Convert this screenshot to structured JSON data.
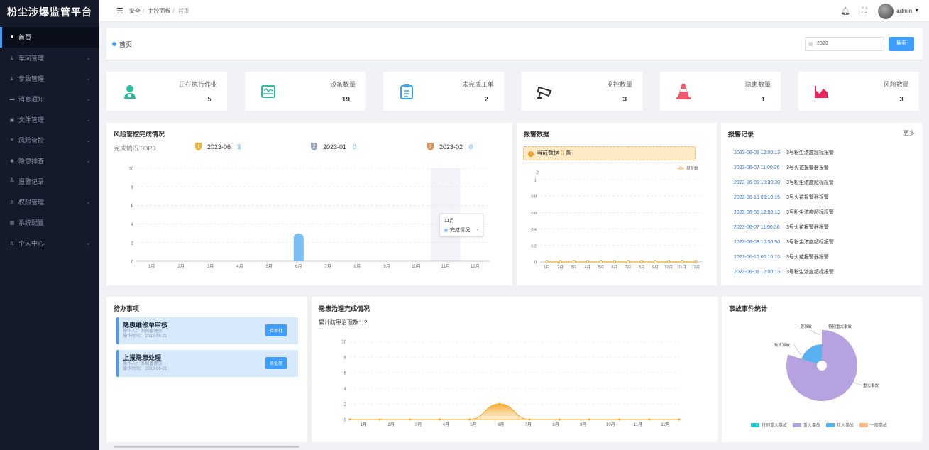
{
  "app": {
    "title": "粉尘涉爆监管平台"
  },
  "sidebar": {
    "items": [
      {
        "label": "首页",
        "icon": "home-icon",
        "glyph": "■"
      },
      {
        "label": "车间管理",
        "icon": "user-icon",
        "glyph": "ﾑ"
      },
      {
        "label": "参数管理",
        "icon": "user-icon",
        "glyph": "ﾑ"
      },
      {
        "label": "消息通知",
        "icon": "message-icon",
        "glyph": "▬"
      },
      {
        "label": "文件管理",
        "icon": "file-icon",
        "glyph": "▣"
      },
      {
        "label": "风险管控",
        "icon": "list-icon",
        "glyph": "≡"
      },
      {
        "label": "隐患排查",
        "icon": "gear-icon",
        "glyph": "✱"
      },
      {
        "label": "报警记录",
        "icon": "chart-icon",
        "glyph": "╩"
      },
      {
        "label": "权限管理",
        "icon": "bars-icon",
        "glyph": "Ⅲ"
      },
      {
        "label": "系统配置",
        "icon": "monitor-icon",
        "glyph": "▦"
      },
      {
        "label": "个人中心",
        "icon": "bars-icon",
        "glyph": "Ⅲ"
      }
    ]
  },
  "breadcrumb": [
    "安全",
    "主控面板",
    "首页"
  ],
  "topbar": {
    "user": "admin"
  },
  "page": {
    "title": "首页",
    "year_value": "2023",
    "search_label": "搜索"
  },
  "stats": [
    {
      "label": "正在执行作业",
      "value": "5",
      "color": "#2bbfa0",
      "icon": "worker-icon"
    },
    {
      "label": "设备数量",
      "value": "19",
      "color": "#2bbfa0",
      "icon": "device-icon"
    },
    {
      "label": "未完成工单",
      "value": "2",
      "color": "#3ba6e8",
      "icon": "clipboard-icon"
    },
    {
      "label": "监控数量",
      "value": "3",
      "color": "#333333",
      "icon": "camera-icon"
    },
    {
      "label": "隐患数量",
      "value": "1",
      "color": "#f25a6b",
      "icon": "cone-icon"
    },
    {
      "label": "风险数量",
      "value": "3",
      "color": "#e8265e",
      "icon": "area-chart-icon"
    }
  ],
  "risk": {
    "title": "风险管控完成情况",
    "subtitle": "完成情况TOP3",
    "top": [
      {
        "date": "2023-06",
        "value": "3",
        "color": "#f0b23c",
        "num": "1"
      },
      {
        "date": "2023-01",
        "value": "0",
        "color": "#9aa6bd",
        "num": "2"
      },
      {
        "date": "2023-02",
        "value": "0",
        "color": "#d9925a",
        "num": "3"
      }
    ],
    "tooltip": {
      "title": "11月",
      "series": "完成情况",
      "value": "-"
    }
  },
  "alarm": {
    "title": "报警数据",
    "notice_prefix": "当前数据",
    "notice_count": "0",
    "notice_unit": "条",
    "legend": "报警数",
    "yunit": "次"
  },
  "records": {
    "title": "报警记录",
    "more": "更多",
    "items": [
      {
        "date": "2023-06-08 12:00:13",
        "content": "3号粉尘浓度超标报警"
      },
      {
        "date": "2023-06-07 11:00:36",
        "content": "3号火花报警器报警"
      },
      {
        "date": "2023-06-09 10:30:30",
        "content": "3号粉尘浓度超标报警"
      },
      {
        "date": "2023-06-10 06:10:15",
        "content": "3号火花报警器报警"
      },
      {
        "date": "2023-06-08 12:00:13",
        "content": "3号粉尘浓度超标报警"
      },
      {
        "date": "2023-06-07 11:00:36",
        "content": "3号火花报警器报警"
      },
      {
        "date": "2023-06-09 10:30:30",
        "content": "3号粉尘浓度超标报警"
      },
      {
        "date": "2023-06-10 06:10:15",
        "content": "3号火花报警器报警"
      },
      {
        "date": "2023-06-08 12:00:13",
        "content": "3号粉尘浓度超标报警"
      },
      {
        "date": "2023-06-07 11:00:36",
        "content": "3号火花报警器报警"
      }
    ]
  },
  "todo": {
    "title": "待办事项",
    "items": [
      {
        "title": "隐患维修单审核",
        "operator": "操作人：  系统管理员",
        "time": "操作时间：  2023-06-21",
        "button": "待审批"
      },
      {
        "title": "上报隐患处理",
        "operator": "操作人：  系统管理员",
        "time": "操作时间：  2023-06-21",
        "button": "待处理"
      }
    ]
  },
  "hazard": {
    "title": "隐患治理完成情况",
    "total_label": "累计防患治理数：",
    "total": "2"
  },
  "accident": {
    "title": "事故事件统计"
  },
  "chart_data": [
    {
      "type": "bar",
      "title": "风险管控完成情况",
      "categories": [
        "1月",
        "2月",
        "3月",
        "4月",
        "5月",
        "6月",
        "7月",
        "8月",
        "9月",
        "10月",
        "11月",
        "12月"
      ],
      "series": [
        {
          "name": "完成情况",
          "values": [
            0,
            0,
            0,
            0,
            0,
            3,
            0,
            0,
            0,
            0,
            0,
            0
          ]
        }
      ],
      "ylim": [
        0,
        10
      ],
      "yticks": [
        0,
        2,
        4,
        6,
        8,
        10
      ]
    },
    {
      "type": "line",
      "title": "报警数据",
      "categories": [
        "1月",
        "2月",
        "3月",
        "4月",
        "5月",
        "6月",
        "7月",
        "8月",
        "9月",
        "10月",
        "11月",
        "12月"
      ],
      "series": [
        {
          "name": "报警数",
          "values": [
            0,
            0,
            0,
            0,
            0,
            0,
            0,
            0,
            0,
            0,
            0,
            0
          ],
          "color": "#f5a623"
        }
      ],
      "ylim": [
        0,
        1
      ],
      "yticks": [
        0,
        0.2,
        0.4,
        0.6,
        0.8,
        1
      ],
      "ylabel": "次"
    },
    {
      "type": "area",
      "title": "隐患治理完成情况",
      "categories": [
        "1月",
        "2月",
        "3月",
        "4月",
        "5月",
        "6月",
        "7月",
        "8月",
        "9月",
        "10月",
        "11月",
        "12月"
      ],
      "series": [
        {
          "values": [
            0,
            0,
            0,
            0,
            0,
            2,
            0,
            0,
            0,
            0,
            0,
            0
          ],
          "color": "#f5a623"
        }
      ],
      "ylim": [
        0,
        10
      ],
      "yticks": [
        0,
        2,
        4,
        6,
        8,
        10
      ]
    },
    {
      "type": "pie",
      "title": "事故事件统计",
      "slices": [
        {
          "label": "特别重大事故",
          "value": 0,
          "color": "#2ec7c9"
        },
        {
          "label": "重大事故",
          "value": 4,
          "color": "#b6a2de"
        },
        {
          "label": "较大事故",
          "value": 1,
          "color": "#5ab1ef"
        },
        {
          "label": "一般事故",
          "value": 0,
          "color": "#ffb980"
        }
      ]
    }
  ]
}
